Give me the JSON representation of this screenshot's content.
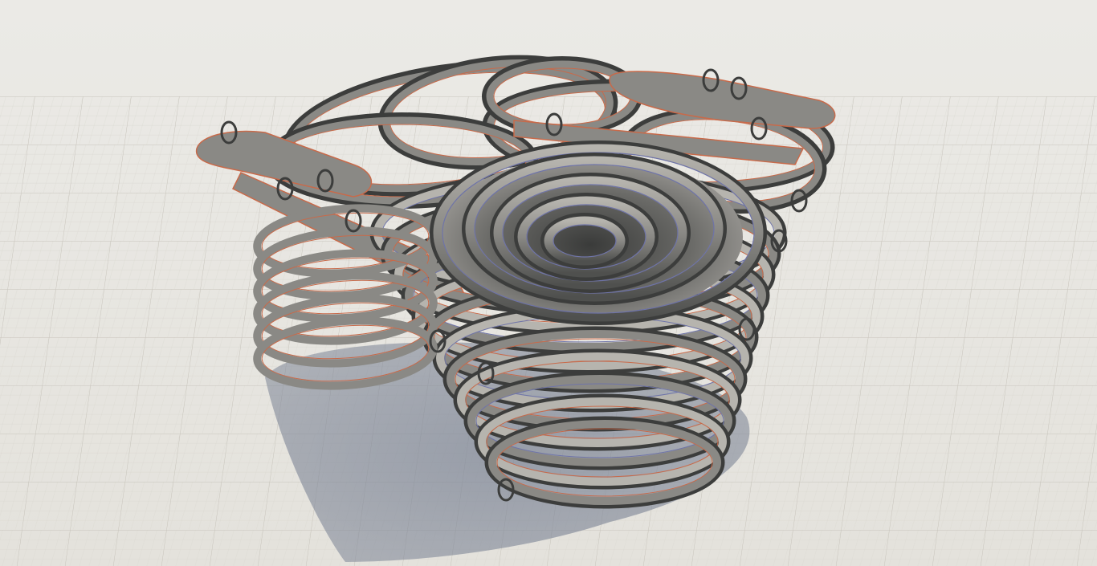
{
  "scene": {
    "kind": "3d-track-editor-viewport",
    "ui_text": [],
    "colors": {
      "sky_top": "#ebeae6",
      "sky_bottom": "#e4e2dc",
      "floor": "#ebe9e2",
      "grid_minor": "#d6d3cb",
      "grid_major": "#c2beb5",
      "shadow": "#7d8596",
      "track_surface": "#8a8985",
      "track_dark": "#4f504e",
      "track_light": "#b6b4ae",
      "track_edge": "#3c3d3c",
      "accent_edge": "#c86a4a",
      "blue_edge": "#6f74a8"
    },
    "objects": [
      {
        "name": "track-stack-shadow",
        "type": "shadow"
      },
      {
        "name": "back-oval-tracks",
        "type": "track-group"
      },
      {
        "name": "left-start-platform",
        "type": "platform"
      },
      {
        "name": "right-start-platform",
        "type": "platform"
      },
      {
        "name": "spiral-funnel-track",
        "type": "track-group"
      },
      {
        "name": "loop-rings",
        "type": "loop-group"
      }
    ]
  }
}
